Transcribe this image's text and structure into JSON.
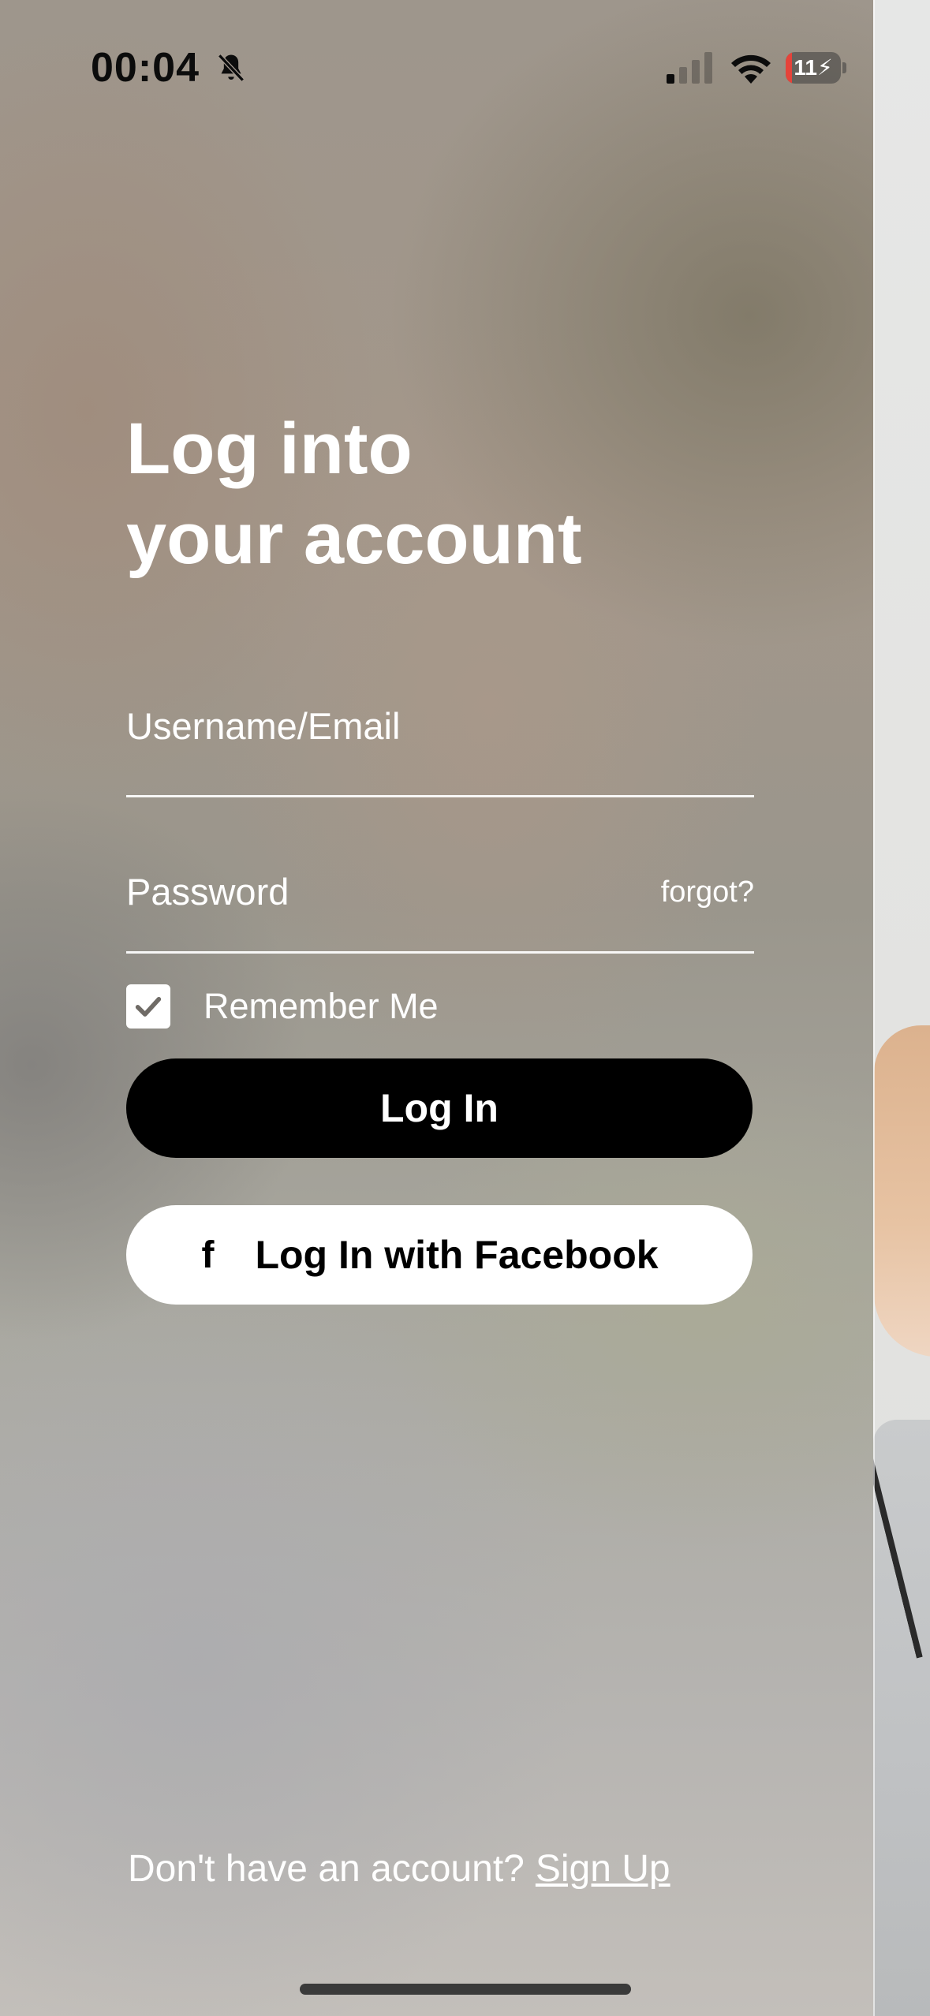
{
  "status_bar": {
    "time": "00:04",
    "battery_level": "11",
    "battery_fraction": 0.11,
    "icons": [
      "bell-slash-icon",
      "cellular-signal-icon",
      "wifi-icon",
      "battery-charging-icon"
    ]
  },
  "login": {
    "title_line1": "Log into",
    "title_line2": "your account",
    "username_placeholder": "Username/Email",
    "username_value": "",
    "password_placeholder": "Password",
    "password_value": "",
    "forgot_label": "forgot?",
    "remember_label": "Remember Me",
    "remember_checked": true,
    "login_button": "Log In",
    "facebook_icon": "f",
    "facebook_button": "Log In with Facebook"
  },
  "footer": {
    "prompt": "Don't have an account?",
    "signup_label": "Sign Up"
  },
  "colors": {
    "primary_button": "#000000",
    "secondary_button": "#ffffff",
    "text": "#ffffff",
    "battery_low": "#e5433a"
  }
}
